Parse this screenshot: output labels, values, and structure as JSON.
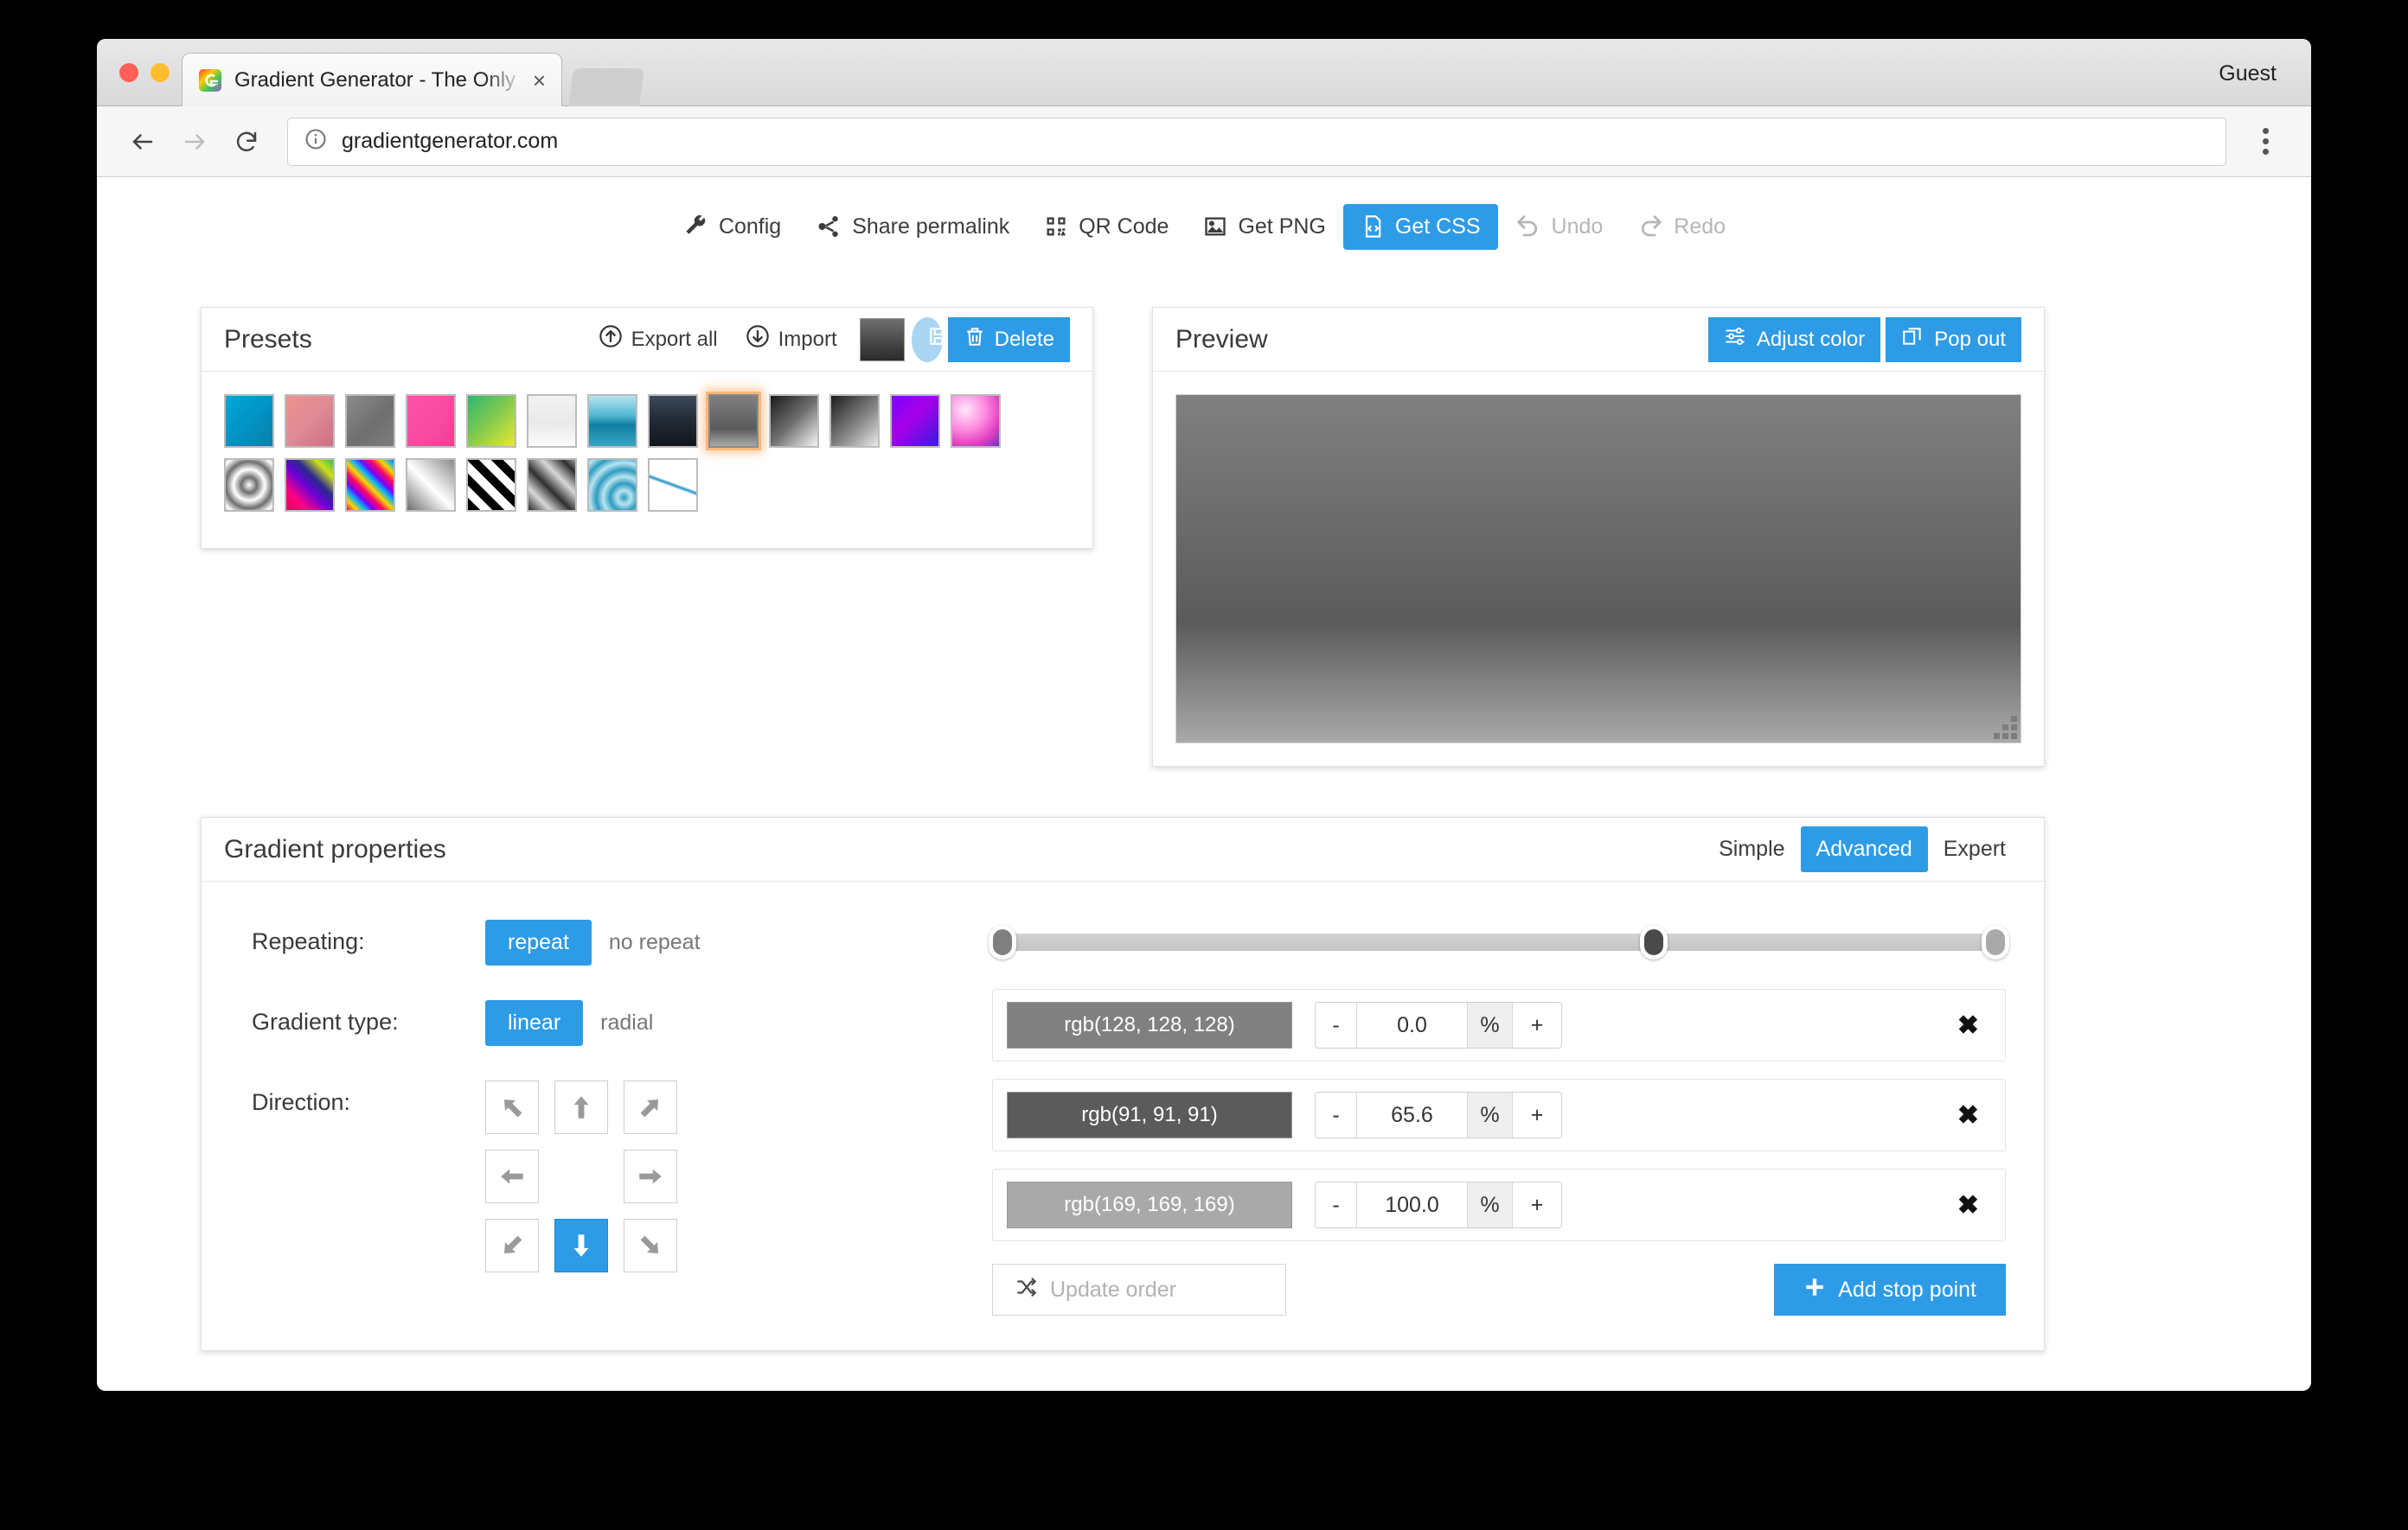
{
  "browser": {
    "tab_title": "Gradient Generator - The Only",
    "tab_close": "×",
    "profile_label": "Guest",
    "url": "gradientgenerator.com",
    "back_icon": "back-arrow-icon",
    "forward_icon": "forward-arrow-icon",
    "reload_icon": "reload-icon",
    "info_icon": "info-icon",
    "menu_icon": "kebab-menu-icon"
  },
  "app_toolbar": {
    "items": [
      {
        "label": "Config",
        "icon": "wrench-icon",
        "state": "normal"
      },
      {
        "label": "Share permalink",
        "icon": "share-icon",
        "state": "normal"
      },
      {
        "label": "QR Code",
        "icon": "qr-code-icon",
        "state": "normal"
      },
      {
        "label": "Get PNG",
        "icon": "image-icon",
        "state": "normal"
      },
      {
        "label": "Get CSS",
        "icon": "code-file-icon",
        "state": "active"
      },
      {
        "label": "Undo",
        "icon": "undo-icon",
        "state": "disabled"
      },
      {
        "label": "Redo",
        "icon": "redo-icon",
        "state": "disabled"
      }
    ]
  },
  "presets": {
    "title": "Presets",
    "export_all_label": "Export all",
    "import_label": "Import",
    "save_label": "Save",
    "delete_label": "Delete",
    "current_swatch_css": "linear-gradient(#6f6f6f, #2a2a2a)",
    "selected_index": 8,
    "row1": [
      "linear-gradient(135deg,#00a8d6 0%,#0096c8 45%,#0b7ea8 100%)",
      "linear-gradient(135deg,#f0928f 0%,#e08a95 50%,#cc6f85 100%)",
      "linear-gradient(135deg,#8b8b8b 0%,#6f6f6f 55%,#7d7d7d 100%)",
      "linear-gradient(135deg,#ff52a8 0%,#f94ba0 55%,#ef3f95 100%)",
      "linear-gradient(135deg,#2eb872 0%,#7cc850 45%,#e8e830 100%)",
      "linear-gradient(#f2f2f2 0%,#e9e9e9 55%,#fdfdfd 100%)",
      "linear-gradient(#b8e4ef 0%,#4fb6d0 40%,#0e7fa0 58%,#3aa6c4 100%)",
      "linear-gradient(#3d4a5c 0%,#232c38 45%,#11161d 100%)",
      "linear-gradient(#808080 0%,#5b5b5b 65.6%,#a9a9a9 100%)",
      "linear-gradient(135deg,#1a1a1a 0%,#6e6e6e 50%,#f5f5f5 100%)",
      "linear-gradient(135deg,#1c1c1c 0%,#8d8d8d 60%,#eaeaea 100%)",
      "linear-gradient(135deg,#7d00ff 0%,#a500e8 45%,#3b1ae0 100%)",
      "radial-gradient(circle at 28% 28%,#ffe8fb 0%,#ff8ce0 40%,#e03ec0 72%,#6a35c8 100%)"
    ],
    "row2": [
      "repeating-radial-gradient(circle at 50% 50%,#ffffff 0px,#6f6f6f 9px,#ffffff 18px)",
      "linear-gradient(45deg,#e8005a 0%,#ff0080 22%,#6a00d8 46%,#2a2a8c 62%,#d0e020 82%,#35c04a 100%)",
      "repeating-linear-gradient(45deg,#ff0066 0px,#ffd400 8px,#00b0ff 16px,#7a00ff 22px,#ff0066 30px)",
      "linear-gradient(45deg,#6f6f6f 0%,#ffffff 48%,#8b8b8b 100%)",
      "repeating-linear-gradient(45deg,#000000 0px,#000000 10px,#ffffff 10px,#ffffff 20px)",
      "repeating-linear-gradient(45deg,#2a2a2a 0px,#d8d8d8 18px,#3a3a3a 34px)",
      "repeating-radial-gradient(circle at 75% 75%,#2e9bc0 0px,#b9e4f0 8px,#2e9bc0 16px)",
      "linear-gradient(200deg,rgba(255,255,255,0) 46%,#1e90c8 50%,rgba(255,255,255,0) 54%)"
    ]
  },
  "preview": {
    "title": "Preview",
    "adjust_color_label": "Adjust color",
    "pop_out_label": "Pop out",
    "adjust_icon": "sliders-icon",
    "popout_icon": "popout-icon",
    "gradient_css": "linear-gradient(180deg, rgb(128,128,128) 0%, rgb(91,91,91) 65.6%, rgb(169,169,169) 100%)",
    "resize_handle": "resize-grip"
  },
  "properties": {
    "title": "Gradient properties",
    "modes": [
      {
        "label": "Simple",
        "active": false
      },
      {
        "label": "Advanced",
        "active": true
      },
      {
        "label": "Expert",
        "active": false
      }
    ],
    "repeating": {
      "label": "Repeating:",
      "on_label": "repeat",
      "off_label": "no repeat",
      "selected": "repeat"
    },
    "gradient_type": {
      "label": "Gradient type:",
      "on_label": "linear",
      "off_label": "radial",
      "selected": "linear"
    },
    "direction": {
      "label": "Direction:",
      "buttons": [
        {
          "name": "up-left",
          "glyph": "↖",
          "active": false
        },
        {
          "name": "up",
          "glyph": "↑",
          "active": false
        },
        {
          "name": "up-right",
          "glyph": "↗",
          "active": false
        },
        {
          "name": "left",
          "glyph": "←",
          "active": false
        },
        {
          "name": "center",
          "glyph": "",
          "active": false
        },
        {
          "name": "right",
          "glyph": "→",
          "active": false
        },
        {
          "name": "down-left",
          "glyph": "↙",
          "active": false
        },
        {
          "name": "down",
          "glyph": "↓",
          "active": true
        },
        {
          "name": "down-right",
          "glyph": "↘",
          "active": false
        }
      ]
    },
    "slider_handles": [
      {
        "position": 0,
        "color": "#808080"
      },
      {
        "position": 65.6,
        "color": "#4a4a4a"
      },
      {
        "position": 100,
        "color": "#a9a9a9"
      }
    ],
    "stops": [
      {
        "color_label": "rgb(128, 128, 128)",
        "color": "#808080",
        "value": "0.0",
        "unit": "%",
        "minus": "-",
        "plus": "+",
        "delete": "✖"
      },
      {
        "color_label": "rgb(91, 91, 91)",
        "color": "#5b5b5b",
        "value": "65.6",
        "unit": "%",
        "minus": "-",
        "plus": "+",
        "delete": "✖"
      },
      {
        "color_label": "rgb(169, 169, 169)",
        "color": "#a9a9a9",
        "value": "100.0",
        "unit": "%",
        "minus": "-",
        "plus": "+",
        "delete": "✖"
      }
    ],
    "update_order_label": "Update order",
    "update_order_icon": "shuffle-icon",
    "add_stop_label": "Add stop point",
    "add_stop_icon": "plus-icon"
  },
  "colors": {
    "accent": "#2e9be6",
    "accent_light": "#a9d5f2",
    "selection_glow": "#f9a050"
  }
}
